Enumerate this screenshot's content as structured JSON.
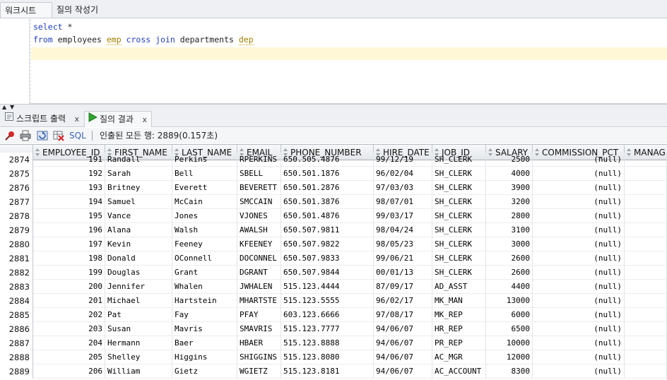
{
  "top_tabs": [
    "워크시트",
    "질의 작성기"
  ],
  "editor": {
    "line1": {
      "kw1": "select",
      "rest": " *"
    },
    "line2": {
      "kw1": "from",
      "t1": " employees ",
      "a1": "emp",
      "kw2": " cross join",
      "t2": " departments ",
      "a2": "dep"
    }
  },
  "bottom_tabs": [
    {
      "label": "스크립트 출력",
      "close": "x",
      "icon": "script-output-icon"
    },
    {
      "label": "질의 결과",
      "close": "x",
      "icon": "run-arrow-icon"
    }
  ],
  "toolbar": {
    "sql_label": "SQL",
    "status": "인출된 모든 행: 2889(0.157초)"
  },
  "colors": {
    "keyword": "#1f3fbf",
    "alias": "#a08000",
    "current_line": "#fff7d6",
    "sql_link": "#3a63b5"
  },
  "grid": {
    "columns": [
      "EMPLOYEE_ID",
      "FIRST_NAME",
      "LAST_NAME",
      "EMAIL",
      "PHONE_NUMBER",
      "HIRE_DATE",
      "JOB_ID",
      "SALARY",
      "COMMISSION_PCT",
      "MANAG"
    ],
    "partial_row": {
      "num": "2874",
      "cells": [
        "191",
        "Randall",
        "Perkins",
        "RPERKINS",
        "650.505.4876",
        "99/12/19",
        "SH_CLERK",
        "2500",
        "(null)",
        ""
      ]
    },
    "rows": [
      {
        "num": "2875",
        "cells": [
          "192",
          "Sarah",
          "Bell",
          "SBELL",
          "650.501.1876",
          "96/02/04",
          "SH_CLERK",
          "4000",
          "(null)",
          ""
        ]
      },
      {
        "num": "2876",
        "cells": [
          "193",
          "Britney",
          "Everett",
          "BEVERETT",
          "650.501.2876",
          "97/03/03",
          "SH_CLERK",
          "3900",
          "(null)",
          ""
        ]
      },
      {
        "num": "2877",
        "cells": [
          "194",
          "Samuel",
          "McCain",
          "SMCCAIN",
          "650.501.3876",
          "98/07/01",
          "SH_CLERK",
          "3200",
          "(null)",
          ""
        ]
      },
      {
        "num": "2878",
        "cells": [
          "195",
          "Vance",
          "Jones",
          "VJONES",
          "650.501.4876",
          "99/03/17",
          "SH_CLERK",
          "2800",
          "(null)",
          ""
        ]
      },
      {
        "num": "2879",
        "cells": [
          "196",
          "Alana",
          "Walsh",
          "AWALSH",
          "650.507.9811",
          "98/04/24",
          "SH_CLERK",
          "3100",
          "(null)",
          ""
        ]
      },
      {
        "num": "2880",
        "cells": [
          "197",
          "Kevin",
          "Feeney",
          "KFEENEY",
          "650.507.9822",
          "98/05/23",
          "SH_CLERK",
          "3000",
          "(null)",
          ""
        ]
      },
      {
        "num": "2881",
        "cells": [
          "198",
          "Donald",
          "OConnell",
          "DOCONNEL",
          "650.507.9833",
          "99/06/21",
          "SH_CLERK",
          "2600",
          "(null)",
          ""
        ]
      },
      {
        "num": "2882",
        "cells": [
          "199",
          "Douglas",
          "Grant",
          "DGRANT",
          "650.507.9844",
          "00/01/13",
          "SH_CLERK",
          "2600",
          "(null)",
          ""
        ]
      },
      {
        "num": "2883",
        "cells": [
          "200",
          "Jennifer",
          "Whalen",
          "JWHALEN",
          "515.123.4444",
          "87/09/17",
          "AD_ASST",
          "4400",
          "(null)",
          ""
        ]
      },
      {
        "num": "2884",
        "cells": [
          "201",
          "Michael",
          "Hartstein",
          "MHARTSTE",
          "515.123.5555",
          "96/02/17",
          "MK_MAN",
          "13000",
          "(null)",
          ""
        ]
      },
      {
        "num": "2885",
        "cells": [
          "202",
          "Pat",
          "Fay",
          "PFAY",
          "603.123.6666",
          "97/08/17",
          "MK_REP",
          "6000",
          "(null)",
          ""
        ]
      },
      {
        "num": "2886",
        "cells": [
          "203",
          "Susan",
          "Mavris",
          "SMAVRIS",
          "515.123.7777",
          "94/06/07",
          "HR_REP",
          "6500",
          "(null)",
          ""
        ]
      },
      {
        "num": "2887",
        "cells": [
          "204",
          "Hermann",
          "Baer",
          "HBAER",
          "515.123.8888",
          "94/06/07",
          "PR_REP",
          "10000",
          "(null)",
          ""
        ]
      },
      {
        "num": "2888",
        "cells": [
          "205",
          "Shelley",
          "Higgins",
          "SHIGGINS",
          "515.123.8080",
          "94/06/07",
          "AC_MGR",
          "12000",
          "(null)",
          ""
        ]
      },
      {
        "num": "2889",
        "cells": [
          "206",
          "William",
          "Gietz",
          "WGIETZ",
          "515.123.8181",
          "94/06/07",
          "AC_ACCOUNT",
          "8300",
          "(null)",
          ""
        ]
      }
    ]
  }
}
